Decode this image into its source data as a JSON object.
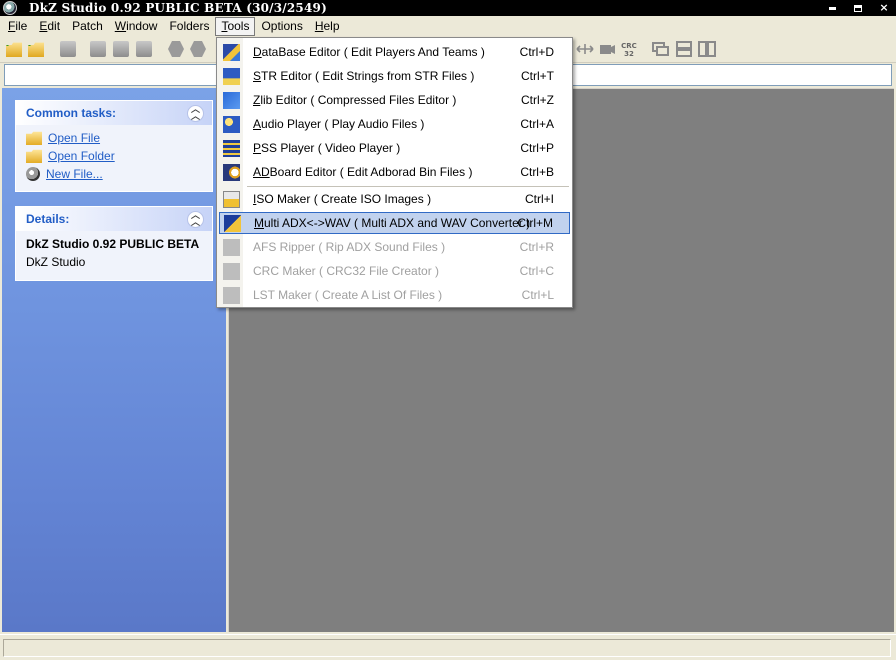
{
  "window": {
    "title": "DkZ Studio 0.92 PUBLIC BETA (30/3/2549)",
    "controls": {
      "minimize": "",
      "maximize": "",
      "close": "×"
    }
  },
  "menubar": {
    "items": [
      {
        "key": "F",
        "rest": "ile"
      },
      {
        "key": "E",
        "rest": "dit"
      },
      {
        "key": "",
        "rest": "Patch"
      },
      {
        "key": "W",
        "rest": "indow"
      },
      {
        "key": "",
        "rest": "Folders"
      },
      {
        "key": "T",
        "rest": "ools"
      },
      {
        "key": "",
        "rest": "Options"
      },
      {
        "key": "H",
        "rest": "elp"
      }
    ]
  },
  "toolbar": {
    "crc_label_top": "CRC",
    "crc_label_bottom": "32"
  },
  "tasks": {
    "common": {
      "title": "Common tasks:",
      "links": [
        {
          "label": "Open File"
        },
        {
          "label": "Open Folder"
        },
        {
          "label": "New File..."
        }
      ]
    },
    "details": {
      "title": "Details:",
      "line1": "DkZ Studio 0.92 PUBLIC BETA",
      "line2": "DkZ Studio"
    }
  },
  "tools_menu": {
    "items": [
      {
        "key": "D",
        "rest": "ataBase Editor ( Edit Players And Teams )",
        "shortcut": "Ctrl+D",
        "enabled": true
      },
      {
        "key": "S",
        "rest": "TR Editor ( Edit Strings from STR Files )",
        "shortcut": "Ctrl+T",
        "enabled": true
      },
      {
        "key": "Z",
        "rest": "lib Editor ( Compressed Files Editor )",
        "shortcut": "Ctrl+Z",
        "enabled": true
      },
      {
        "key": "A",
        "rest": "udio Player ( Play Audio Files )",
        "shortcut": "Ctrl+A",
        "enabled": true
      },
      {
        "key": "P",
        "rest": "SS Player ( Video Player )",
        "shortcut": "Ctrl+P",
        "enabled": true
      },
      {
        "key": "AD",
        "rest": "Board Editor ( Edit Adborad Bin Files )",
        "shortcut": "Ctrl+B",
        "enabled": true
      },
      {
        "key": "I",
        "rest": "SO Maker ( Create ISO Images )",
        "shortcut": "Ctrl+I",
        "enabled": true
      },
      {
        "key": "M",
        "rest": "ulti ADX<->WAV ( Multi  ADX and WAV Converter )",
        "shortcut": "Ctrl+M",
        "enabled": true,
        "highlighted": true
      },
      {
        "key": "",
        "rest": "AFS Ripper ( Rip ADX Sound Files )",
        "shortcut": "Ctrl+R",
        "enabled": false
      },
      {
        "key": "",
        "rest": "CRC Maker ( CRC32 File Creator )",
        "shortcut": "Ctrl+C",
        "enabled": false
      },
      {
        "key": "",
        "rest": "LST Maker ( Create A List Of Files )",
        "shortcut": "Ctrl+L",
        "enabled": false
      }
    ]
  }
}
